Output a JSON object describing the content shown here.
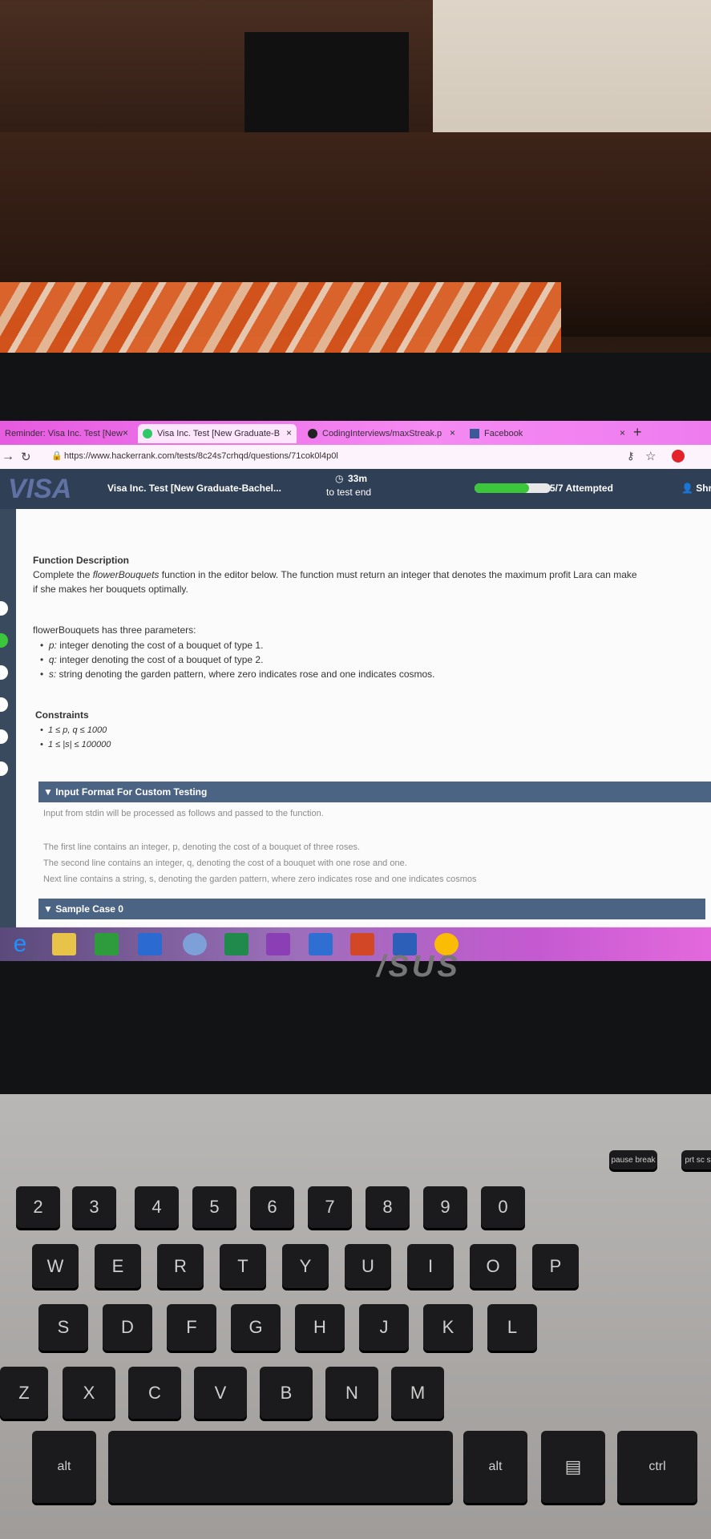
{
  "browser": {
    "tabs": [
      {
        "label": "Reminder: Visa Inc. Test [New",
        "close": "×"
      },
      {
        "label": "Visa Inc. Test [New Graduate-B",
        "close": "×"
      },
      {
        "label": "CodingInterviews/maxStreak.p",
        "close": "×"
      },
      {
        "label": "Facebook",
        "close": "×"
      }
    ],
    "new_tab": "+",
    "url": "https://www.hackerrank.com/tests/8c24s7crhqd/questions/71cok0l4p0l"
  },
  "header": {
    "logo": "VISA",
    "test_title": "Visa Inc. Test [New Graduate-Bachel...",
    "timer_value": "33m",
    "timer_label": "to test end",
    "progress": 0.714,
    "attempted": "5/7 Attempted",
    "user": "Shr"
  },
  "problem": {
    "fd_title": "Function Description",
    "fd_line1_a": "Complete the ",
    "fd_line1_fn": "flowerBouquets",
    "fd_line1_b": " function in the editor below. The function must return an integer that denotes the maximum profit Lara can make",
    "fd_line2": "if she makes her bouquets optimally.",
    "params_intro": "flowerBouquets has three parameters:",
    "params": [
      {
        "name": "p:",
        "desc": " integer denoting the cost of a bouquet of type 1."
      },
      {
        "name": "q:",
        "desc": " integer denoting the cost of a bouquet of type 2."
      },
      {
        "name": "s:",
        "desc": " string denoting the garden pattern, where zero indicates rose and one indicates cosmos."
      }
    ],
    "constraints_title": "Constraints",
    "constraints": [
      "1 ≤ p, q ≤ 1000",
      "1 ≤ |s| ≤ 100000"
    ],
    "input_format_title": "▼ Input Format For Custom Testing",
    "input_intro": "Input from stdin will be processed as follows and passed to the function.",
    "input_lines": [
      "The first line contains an integer, p, denoting the cost of a bouquet of three roses.",
      "The second line contains an integer, q, denoting the cost of a bouquet with one rose and one.",
      "Next line contains a string, s, denoting the garden pattern, where zero indicates rose and one indicates cosmos"
    ],
    "sample_title": "▼ Sample Case 0"
  },
  "laptop_brand": "/SUS",
  "keys": {
    "row_num": [
      "2",
      "3",
      "4",
      "5",
      "6",
      "7",
      "8",
      "9",
      "0"
    ],
    "row_q": [
      "W",
      "E",
      "R",
      "T",
      "Y",
      "U",
      "I",
      "O",
      "P"
    ],
    "row_a": [
      "S",
      "D",
      "F",
      "G",
      "H",
      "J",
      "K",
      "L"
    ],
    "row_z": [
      "Z",
      "X",
      "C",
      "V",
      "B",
      "N",
      "M"
    ],
    "alt": "alt",
    "ctrl": "ctrl",
    "pause": "pause break",
    "prtsc": "prt sc sysrq"
  },
  "colors": {
    "header": "#2f3f56",
    "section": "#4b6484",
    "progress": "#3cc63c",
    "tabbar": "#f58af2"
  }
}
